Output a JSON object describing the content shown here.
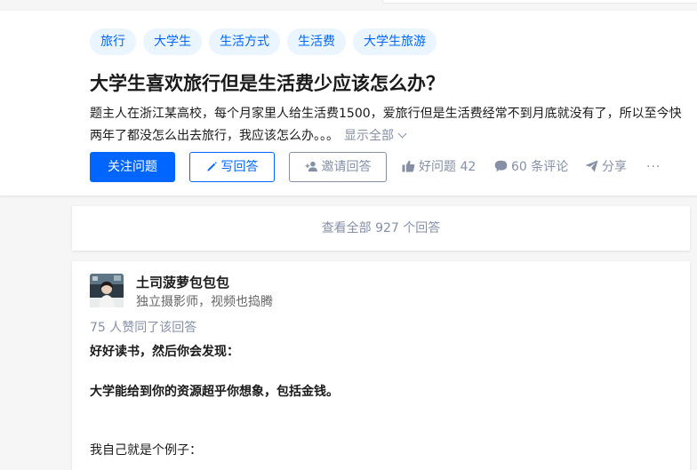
{
  "tags": [
    "旅行",
    "大学生",
    "生活方式",
    "生活费",
    "大学生旅游"
  ],
  "question": {
    "title": "大学生喜欢旅行但是生活费少应该怎么办？",
    "detail": "题主人在浙江某高校，每个月家里人给生活费1500，爱旅行但是生活费经常不到月底就没有了，所以至今快两年了都没怎么出去旅行，我应该怎么办。。。",
    "show_all": "显示全部"
  },
  "actions": {
    "follow": "关注问题",
    "write": "写回答",
    "invite": "邀请回答",
    "good_question": "好问题 42",
    "comments": "60 条评论",
    "share": "分享",
    "more": "···"
  },
  "view_all": "查看全部 927 个回答",
  "answer": {
    "author_name": "土司菠萝包包包",
    "author_bio": "独立摄影师，视频也捣腾",
    "votes": "75 人赞同了该回答",
    "paragraphs": [
      "好好读书，然后你会发现：",
      "大学能给到你的资源超乎你想象，包括金钱。",
      "我自己就是个例子："
    ]
  },
  "colors": {
    "brand_blue": "#0066ff",
    "tag_bg": "#ebf5ff",
    "muted": "#8590a6",
    "page_bg": "#f6f6f6"
  },
  "icons": [
    "pencil-icon",
    "invite-person-icon",
    "thumb-up-icon",
    "comment-bubble-icon",
    "share-plane-icon",
    "more-dots-icon",
    "chevron-down-icon"
  ]
}
